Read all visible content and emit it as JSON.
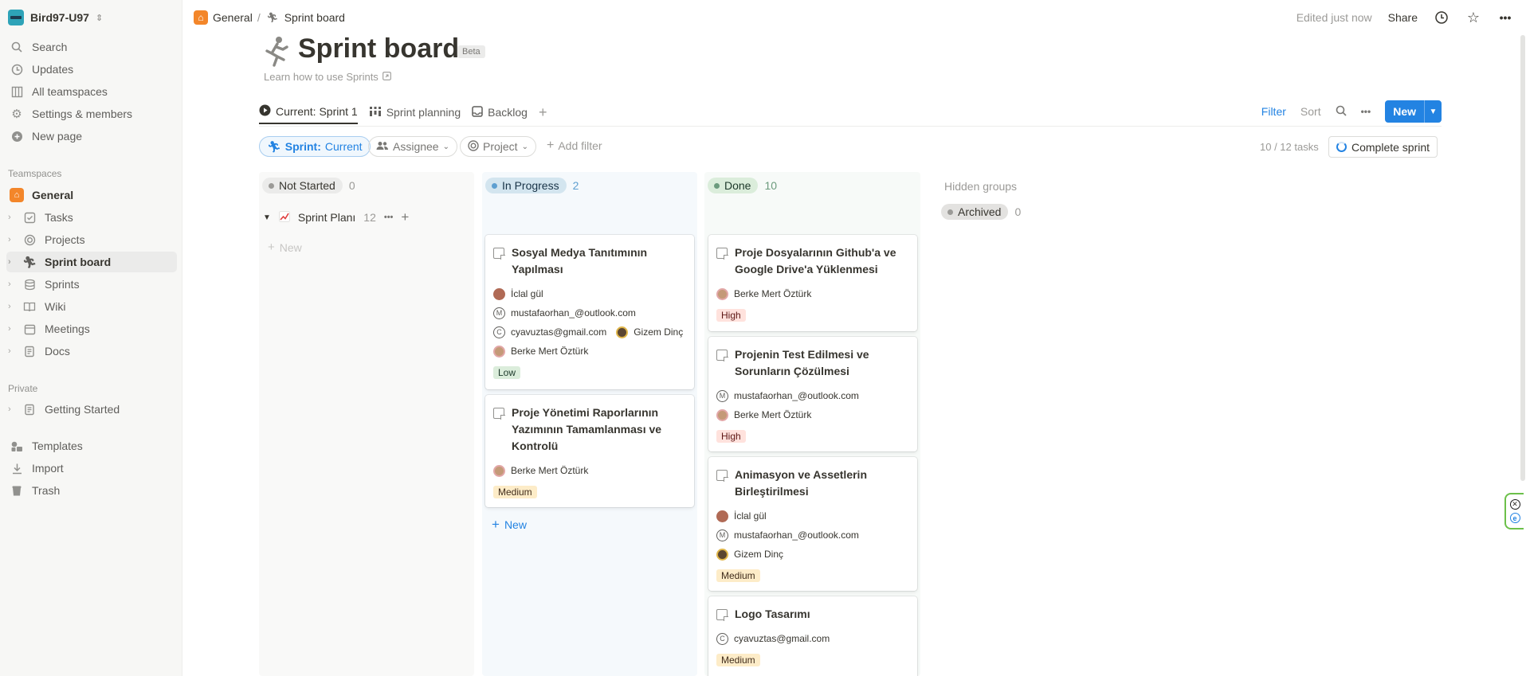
{
  "workspace": {
    "name": "Bird97-U97"
  },
  "sidebar": {
    "top_items": [
      {
        "label": "Search",
        "icon": "search-icon"
      },
      {
        "label": "Updates",
        "icon": "clock-icon"
      },
      {
        "label": "All teamspaces",
        "icon": "grid-icon"
      },
      {
        "label": "Settings & members",
        "icon": "gear-icon"
      },
      {
        "label": "New page",
        "icon": "plus-circle-icon"
      }
    ],
    "teamspaces_label": "Teamspaces",
    "teamspace_items": [
      {
        "label": "General",
        "icon": "house-icon"
      },
      {
        "label": "Tasks",
        "icon": "checkbox-icon"
      },
      {
        "label": "Projects",
        "icon": "target-icon"
      },
      {
        "label": "Sprint board",
        "icon": "runner-icon",
        "active": true
      },
      {
        "label": "Sprints",
        "icon": "stack-icon"
      },
      {
        "label": "Wiki",
        "icon": "book-icon"
      },
      {
        "label": "Meetings",
        "icon": "calendar-icon"
      },
      {
        "label": "Docs",
        "icon": "document-icon"
      }
    ],
    "private_label": "Private",
    "private_items": [
      {
        "label": "Getting Started",
        "icon": "document-icon"
      }
    ],
    "bottom_items": [
      {
        "label": "Templates",
        "icon": "templates-icon"
      },
      {
        "label": "Import",
        "icon": "download-icon"
      },
      {
        "label": "Trash",
        "icon": "trash-icon"
      }
    ]
  },
  "breadcrumb": {
    "parent": "General",
    "separator": "/",
    "current": "Sprint board"
  },
  "topbar": {
    "edited": "Edited just now",
    "share": "Share"
  },
  "page": {
    "title": "Sprint board",
    "badge": "Beta",
    "learn_link": "Learn how to use Sprints"
  },
  "views": {
    "tabs": [
      {
        "label": "Current: Sprint 1",
        "icon": "play-icon",
        "active": true
      },
      {
        "label": "Sprint planning",
        "icon": "board-icon"
      },
      {
        "label": "Backlog",
        "icon": "inbox-icon"
      }
    ],
    "filter_label": "Filter",
    "sort_label": "Sort",
    "new_label": "New"
  },
  "filters": {
    "sprint_prefix": "Sprint:",
    "sprint_value": "Current",
    "assignee": "Assignee",
    "project": "Project",
    "add_filter": "Add filter",
    "tasks_count": "10 / 12 tasks",
    "complete_sprint": "Complete sprint"
  },
  "board": {
    "columns": [
      {
        "label": "Not Started",
        "count": "0",
        "color": "#9b9a97"
      },
      {
        "label": "In Progress",
        "count": "2",
        "color": "#2383e2"
      },
      {
        "label": "Done",
        "count": "10",
        "color": "#4dab6a"
      }
    ],
    "group": {
      "name": "Sprint Planı",
      "count": "12"
    },
    "new_label": "New",
    "hidden_groups_label": "Hidden groups",
    "archived": {
      "label": "Archived",
      "count": "0"
    }
  },
  "cards": {
    "in_progress": [
      {
        "title_lines": [
          "Sosyal Medya Tanıtımının",
          "Yapılması"
        ],
        "people": [
          "İclal gül",
          "mustafaorhan_@outlook.com",
          "cyavuztas@gmail.com",
          "Gizem Dinç",
          "Berke Mert Öztürk"
        ],
        "priority": "Low"
      },
      {
        "title_lines": [
          "Proje Yönetimi Raporlarının",
          "Yazımının Tamamlanması ve",
          "Kontrolü"
        ],
        "people": [
          "Berke Mert Öztürk"
        ],
        "priority": "Medium"
      }
    ],
    "done": [
      {
        "title_lines": [
          "Proje Dosyalarının Github'a ve",
          "Google Drive'a Yüklenmesi"
        ],
        "people": [
          "Berke Mert Öztürk"
        ],
        "priority": "High"
      },
      {
        "title_lines": [
          "Projenin Test Edilmesi ve",
          "Sorunların Çözülmesi"
        ],
        "people": [
          "mustafaorhan_@outlook.com",
          "Berke Mert Öztürk"
        ],
        "priority": "High"
      },
      {
        "title_lines": [
          "Animasyon ve Assetlerin",
          "Birleştirilmesi"
        ],
        "people": [
          "İclal gül",
          "mustafaorhan_@outlook.com",
          "Gizem Dinç"
        ],
        "priority": "Medium"
      },
      {
        "title_lines": [
          "Logo Tasarımı"
        ],
        "people": [
          "cyavuztas@gmail.com"
        ],
        "priority": "Medium"
      }
    ]
  },
  "avatars": {
    "letter_m": "M",
    "letter_c": "C"
  },
  "colors": {
    "accent": "#2383e2",
    "sidebar_bg": "#f7f7f5"
  }
}
